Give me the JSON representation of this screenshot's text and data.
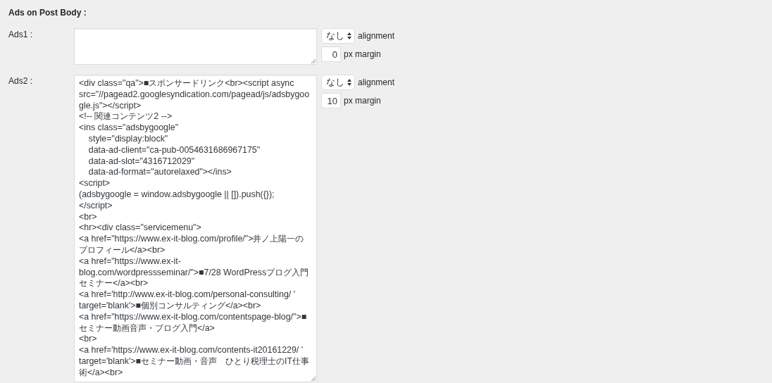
{
  "section_title": "Ads on Post Body :",
  "ads": [
    {
      "label": "Ads1 :",
      "alignment": {
        "value": "なし",
        "label": "alignment"
      },
      "margin": {
        "value": "0",
        "label": "px margin"
      }
    },
    {
      "label": "Ads2 :",
      "code": "<div class=\"qa\">■スポンサードリンク<br><script async src=\"//pagead2.googlesyndication.com/pagead/js/adsbygoogle.js\"></script>\n<!-- 関連コンテンツ2 -->\n<ins class=\"adsbygoogle\"\n    style=\"display:block\"\n    data-ad-client=\"ca-pub-0054631686967175\"\n    data-ad-slot=\"4316712029\"\n    data-ad-format=\"autorelaxed\"></ins>\n<script>\n(adsbygoogle = window.adsbygoogle || []).push({});\n</script>\n<br>\n<hr><div class=\"servicemenu\">\n<a href=\"https://www.ex-it-blog.com/profile/\">井ノ上陽一のプロフィール</a><br>\n<a href=\"https://www.ex-it-blog.com/wordpressseminar/\">■7/28 WordPressブログ入門セミナー</a><br>\n<a href='http://www.ex-it-blog.com/personal-consulting/ ' target='blank'>■個別コンサルティング</a><br>\n<a href=\"https://www.ex-it-blog.com/contentspage-blog/\">■セミナー動画音声・ブログ入門</a>\n<br>\n<a href='https://www.ex-it-blog.com/contents-it20161229/ ' target='blank'>■セミナー動画・音声　ひとり税理士のIT仕事術</a><br>",
      "alignment": {
        "value": "なし",
        "label": "alignment"
      },
      "margin": {
        "value": "10",
        "label": "px margin"
      }
    }
  ]
}
